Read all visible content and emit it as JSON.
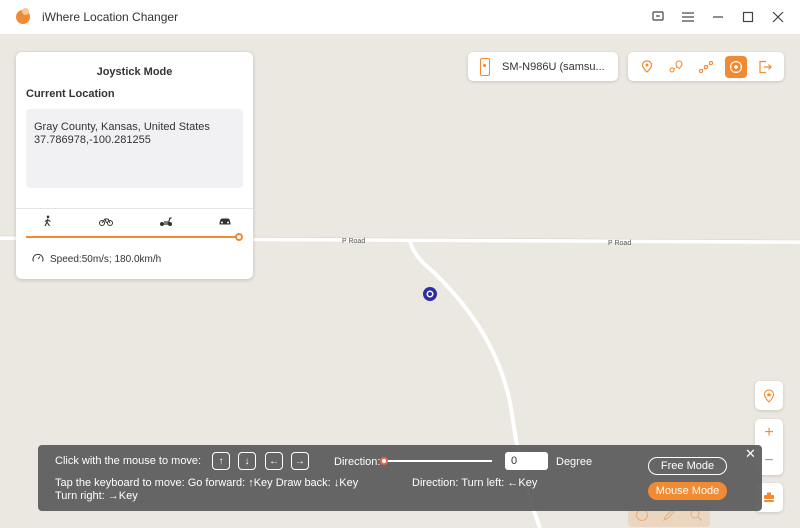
{
  "app": {
    "title": "iWhere Location Changer"
  },
  "window_controls": {
    "feedback": "⍰",
    "menu": "☰",
    "minimize": "—",
    "maximize": "☐",
    "close": "✕"
  },
  "map": {
    "road_labels": [
      "P Road",
      "P Road"
    ]
  },
  "joystick_panel": {
    "title": "Joystick Mode",
    "subtitle": "Current Location",
    "address": "Gray County, Kansas, United States",
    "coordinates": "37.786978,-100.281255",
    "modes": [
      "walk-icon",
      "bike-icon",
      "scooter-icon",
      "car-icon"
    ],
    "speed_fraction": 1.0,
    "speed_text": "Speed:50m/s; 180.0km/h"
  },
  "device": {
    "name": "SM-N986U (samsu..."
  },
  "toolbar": {
    "icons": [
      "teleport-icon",
      "one-stop-icon",
      "multi-stop-icon",
      "joystick-icon",
      "exit-icon"
    ],
    "active": "joystick-icon"
  },
  "controls": {
    "mouse_label": "Click with the mouse to move:",
    "arrows": [
      "↑",
      "↓",
      "←",
      "→"
    ],
    "direction_label": "Direction:",
    "direction_value": "0",
    "degree_label": "Degree",
    "keyboard_line1": "Tap the keyboard to move: Go forward: ↑Key Draw back: ↓Key",
    "keyboard_line2": "Turn right: →Key",
    "turn_left": "Direction: Turn left: ←Key",
    "free_mode": "Free Mode",
    "mouse_mode": "Mouse Mode",
    "close": "✕"
  },
  "colors": {
    "accent": "#f08a33",
    "map_bg": "#ebe7e1",
    "marker": "#3a3aa8"
  }
}
